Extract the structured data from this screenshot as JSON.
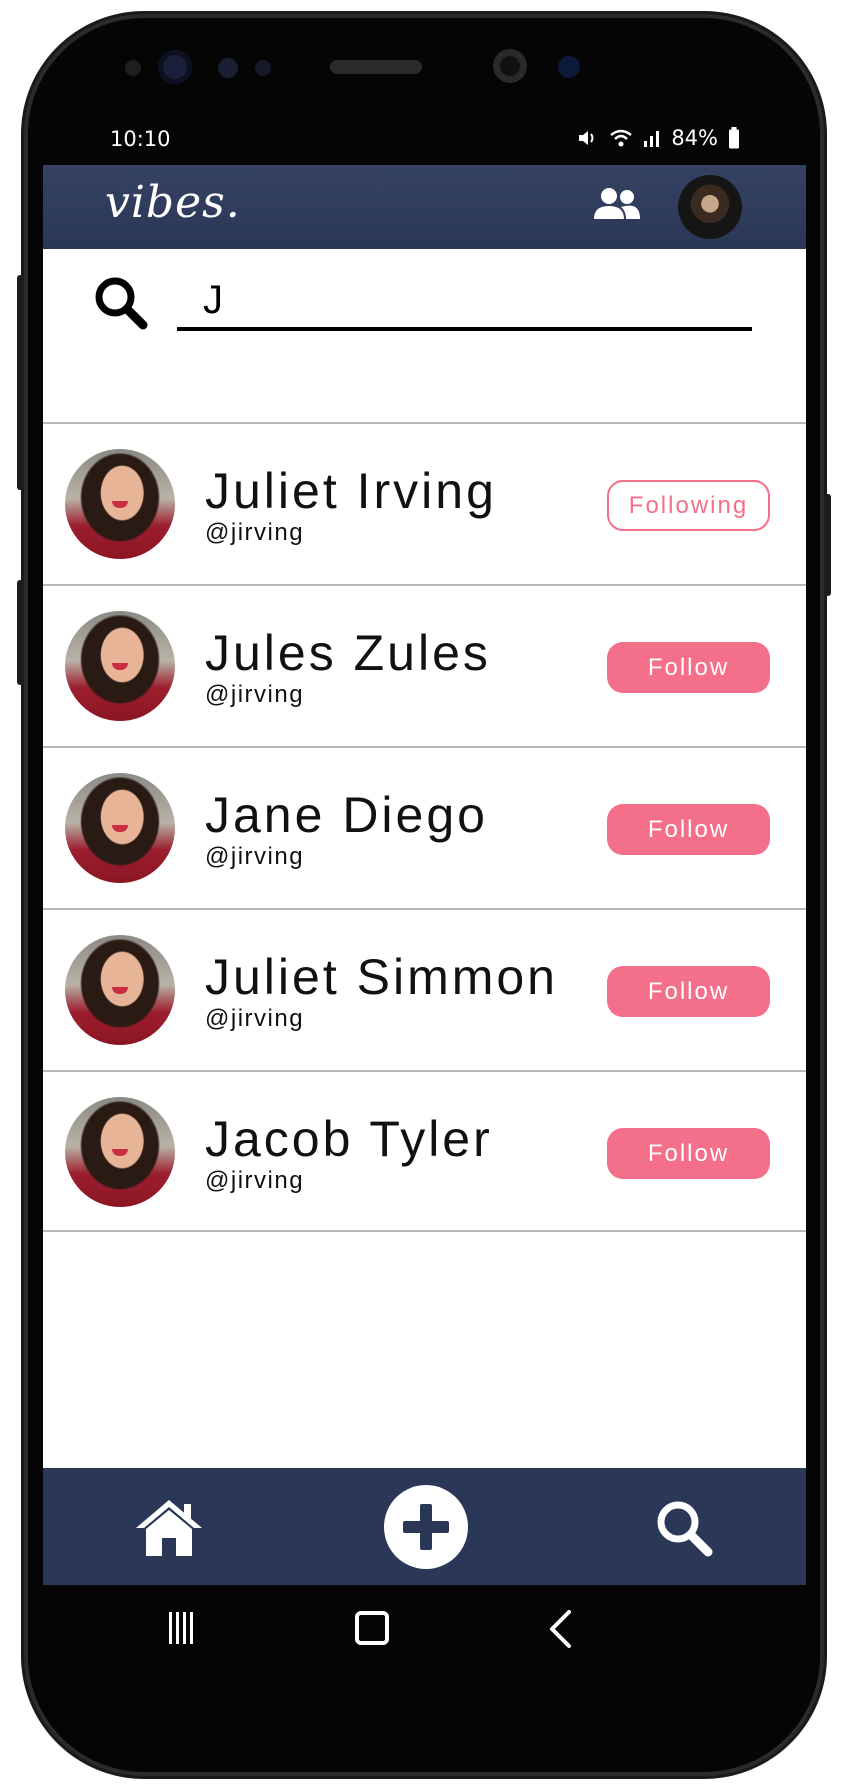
{
  "status_bar": {
    "time": "10:10",
    "battery": "84%"
  },
  "app": {
    "logo": "vibes."
  },
  "search": {
    "value": "J"
  },
  "results": [
    {
      "name": "Juliet Irving",
      "handle": "@jirving",
      "button": "Following",
      "state": "following"
    },
    {
      "name": "Jules Zules",
      "handle": "@jirving",
      "button": "Follow",
      "state": "follow"
    },
    {
      "name": "Jane Diego",
      "handle": "@jirving",
      "button": "Follow",
      "state": "follow"
    },
    {
      "name": "Juliet Simmon",
      "handle": "@jirving",
      "button": "Follow",
      "state": "follow"
    },
    {
      "name": "Jacob Tyler",
      "handle": "@jirving",
      "button": "Follow",
      "state": "follow"
    }
  ],
  "icons": {
    "top_bar": [
      "friends-icon",
      "profile-avatar"
    ],
    "bottom_nav": [
      "home-icon",
      "add-icon",
      "search-icon"
    ],
    "system_nav": [
      "recents-icon",
      "home-square-icon",
      "back-icon"
    ]
  },
  "colors": {
    "bar": "#2a3757",
    "accent": "#f46f8a"
  }
}
